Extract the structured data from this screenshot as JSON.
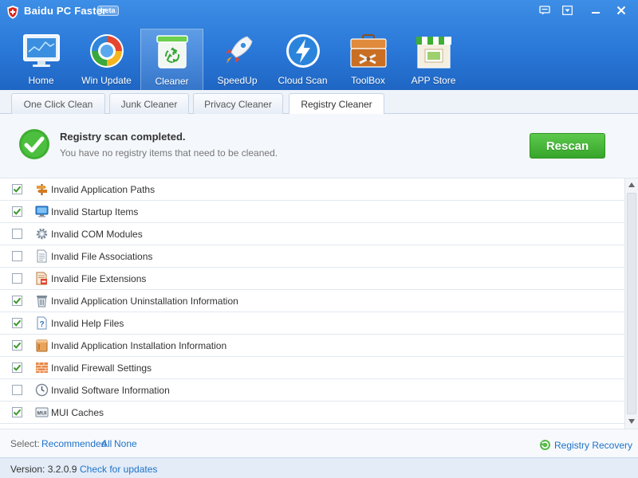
{
  "app": {
    "title": "Baidu PC Faster",
    "badge": "beta"
  },
  "nav": {
    "items": [
      {
        "label": "Home",
        "icon": "home-monitor-icon"
      },
      {
        "label": "Win Update",
        "icon": "win-update-icon"
      },
      {
        "label": "Cleaner",
        "icon": "recycle-bin-icon"
      },
      {
        "label": "SpeedUp",
        "icon": "rocket-icon"
      },
      {
        "label": "Cloud Scan",
        "icon": "lightning-icon"
      },
      {
        "label": "ToolBox",
        "icon": "toolbox-icon"
      },
      {
        "label": "APP Store",
        "icon": "store-icon"
      }
    ],
    "active_index": 2
  },
  "tabs": {
    "items": [
      "One Click Clean",
      "Junk Cleaner",
      "Privacy Cleaner",
      "Registry Cleaner"
    ],
    "active_index": 3
  },
  "status": {
    "title": "Registry scan completed.",
    "subtitle": "You have no registry items that need to be cleaned.",
    "button": "Rescan"
  },
  "registry": {
    "items": [
      {
        "label": "Invalid Application Paths",
        "checked": true,
        "icon": "signpost-icon"
      },
      {
        "label": "Invalid Startup Items",
        "checked": true,
        "icon": "monitor-icon"
      },
      {
        "label": "Invalid COM Modules",
        "checked": false,
        "icon": "gear-icon"
      },
      {
        "label": "Invalid File Associations",
        "checked": false,
        "icon": "document-icon"
      },
      {
        "label": "Invalid File Extensions",
        "checked": false,
        "icon": "file-extension-icon"
      },
      {
        "label": "Invalid Application Uninstallation Information",
        "checked": true,
        "icon": "trash-icon"
      },
      {
        "label": "Invalid Help Files",
        "checked": true,
        "icon": "help-file-icon"
      },
      {
        "label": "Invalid Application Installation Information",
        "checked": true,
        "icon": "package-icon"
      },
      {
        "label": "Invalid Firewall Settings",
        "checked": true,
        "icon": "firewall-icon"
      },
      {
        "label": "Invalid Software Information",
        "checked": false,
        "icon": "clock-icon"
      },
      {
        "label": "MUI Caches",
        "checked": true,
        "icon": "mui-icon"
      }
    ]
  },
  "select_bar": {
    "label": "Select:",
    "recommended": "Recommended",
    "all": "All",
    "none": "None",
    "recovery": "Registry Recovery"
  },
  "footer": {
    "version": "Version: 3.2.0.9",
    "check_updates": "Check for updates"
  },
  "colors": {
    "header_blue": "#2a78d8",
    "accent_green": "#3fae33",
    "link_blue": "#1f72c9"
  }
}
